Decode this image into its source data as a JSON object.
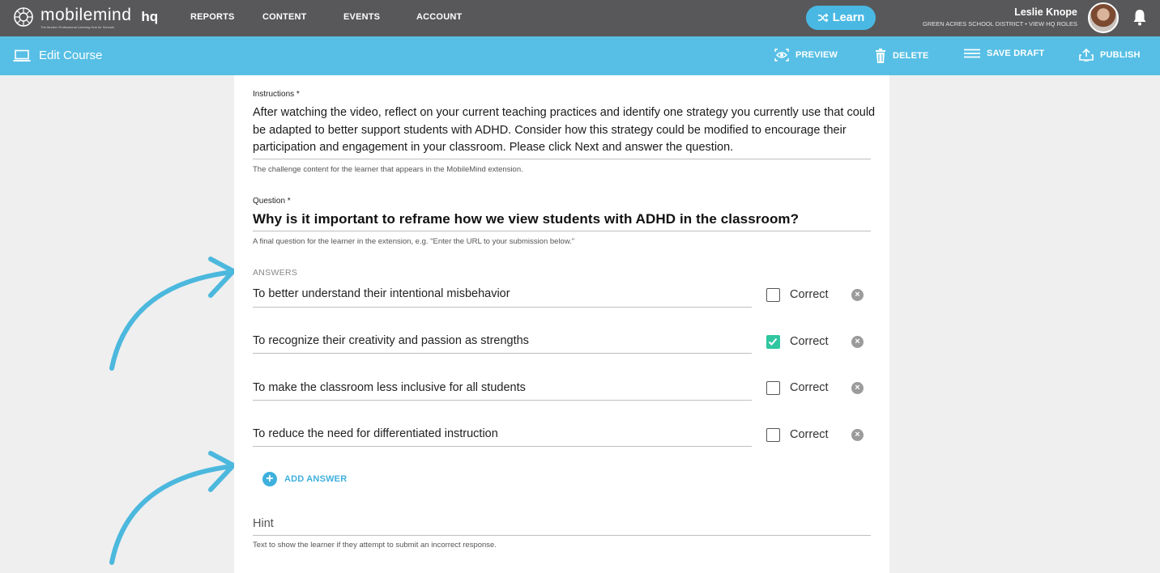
{
  "topbar": {
    "brand_name": "mobilemind",
    "brand_tagline": "The Modern Professional Learning Hub for Schools",
    "brand_suffix": "hq",
    "nav": [
      "REPORTS",
      "CONTENT",
      "EVENTS",
      "ACCOUNT"
    ],
    "learn_label": "Learn",
    "user_name": "Leslie Knope",
    "user_district": "GREEN ACRES SCHOOL DISTRICT • VIEW HQ ROLES"
  },
  "subbar": {
    "title": "Edit Course",
    "actions": {
      "preview": "PREVIEW",
      "delete": "DELETE",
      "save_draft": "SAVE DRAFT",
      "publish": "PUBLISH"
    }
  },
  "form": {
    "instructions_label": "Instructions *",
    "instructions_value": "After watching the video, reflect on your current teaching practices and identify one strategy you currently use that could be adapted to better support students with ADHD. Consider how this strategy could be modified to encourage their participation and engagement in your classroom. Please click Next and answer the question.",
    "instructions_helper": "The challenge content for the learner that appears in the MobileMind extension.",
    "question_label": "Question *",
    "question_value": "Why is it important to reframe how we view students with ADHD in the classroom?",
    "question_helper": "A final question for the learner in the extension, e.g. \"Enter the URL to your submission below.\"",
    "answers_label": "ANSWERS",
    "correct_label": "Correct",
    "answers": [
      {
        "text": "To better understand their intentional misbehavior",
        "correct": false
      },
      {
        "text": "To recognize their creativity and passion as strengths",
        "correct": true
      },
      {
        "text": "To make the classroom less inclusive for all students",
        "correct": false
      },
      {
        "text": "To reduce the need for differentiated instruction",
        "correct": false
      }
    ],
    "add_answer_label": "ADD ANSWER",
    "hint_placeholder": "Hint",
    "hint_helper": "Text to show the learner if they attempt to submit an incorrect response."
  },
  "colors": {
    "topbar": "#58585a",
    "subbar": "#57bfe5",
    "accent": "#3eb0dd",
    "check": "#2fc6a0",
    "arrows": "#4cb8dd"
  }
}
